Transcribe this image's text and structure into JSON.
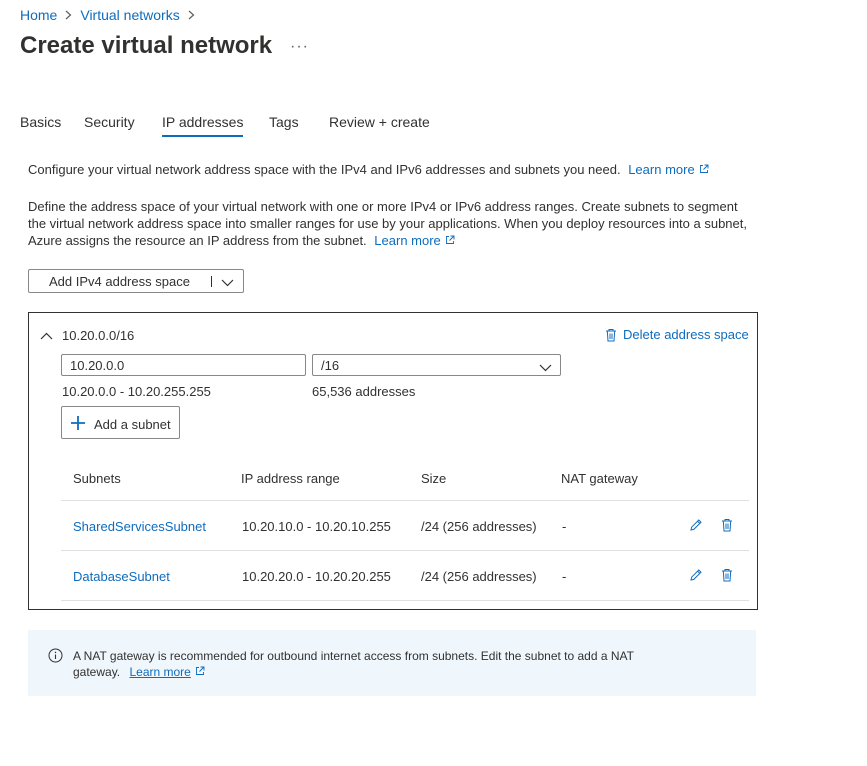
{
  "breadcrumb": {
    "items": [
      "Home",
      "Virtual networks"
    ]
  },
  "page": {
    "title": "Create virtual network",
    "more": "···"
  },
  "tabs": [
    {
      "label": "Basics"
    },
    {
      "label": "Security"
    },
    {
      "label": "IP addresses",
      "active": true
    },
    {
      "label": "Tags"
    },
    {
      "label": "Review + create"
    }
  ],
  "intro": {
    "line1": "Configure your virtual network address space with the IPv4 and IPv6 addresses and subnets you need.",
    "line1_link": "Learn more",
    "line2": "Define the address space of your virtual network with one or more IPv4 or IPv6 address ranges. Create subnets to segment the virtual network address space into smaller ranges for use by your applications. When you deploy resources into a subnet, Azure assigns the resource an IP address from the subnet.",
    "line2_link": "Learn more"
  },
  "add_space_button": {
    "label": "Add IPv4 address space"
  },
  "address_space": {
    "title": "10.20.0.0/16",
    "delete_label": "Delete address space",
    "ip_value": "10.20.0.0",
    "cidr_value": "/16",
    "range_text": "10.20.0.0 - 10.20.255.255",
    "count_text": "65,536 addresses",
    "add_subnet_label": "Add a subnet"
  },
  "subnets_table": {
    "headers": [
      "Subnets",
      "IP address range",
      "Size",
      "NAT gateway"
    ],
    "rows": [
      {
        "name": "SharedServicesSubnet",
        "range": "10.20.10.0 - 10.20.10.255",
        "size": "/24 (256 addresses)",
        "nat": "-"
      },
      {
        "name": "DatabaseSubnet",
        "range": "10.20.20.0 - 10.20.20.255",
        "size": "/24 (256 addresses)",
        "nat": "-"
      }
    ]
  },
  "info_banner": {
    "text": "A NAT gateway is recommended for outbound internet access from subnets. Edit the subnet to add a NAT gateway.",
    "link": "Learn more"
  },
  "colors": {
    "accent": "#0f6cbd",
    "info_bg": "#eff6fc",
    "border": "#8a8886"
  },
  "icons": [
    "chevron-right-icon",
    "external-link-icon",
    "chevron-down-icon",
    "chevron-up-icon",
    "trash-icon",
    "plus-icon",
    "edit-icon",
    "info-icon"
  ]
}
